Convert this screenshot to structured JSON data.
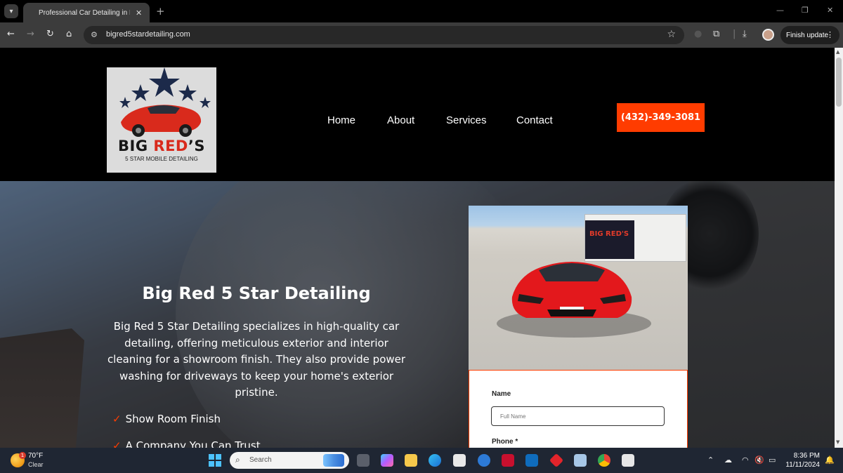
{
  "browser": {
    "tab_title": "Professional Car Detailing in Lu",
    "tab_close": "✕",
    "new_tab": "+",
    "url": "bigred5stardetailing.com",
    "finish_update": "Finish update",
    "window_controls": [
      "—",
      "❐",
      "✕"
    ]
  },
  "site": {
    "logo": {
      "line1_a": "BIG ",
      "line1_b": "RED",
      "line1_c": "’S",
      "line2": "5 STAR MOBILE DETAILING"
    },
    "nav": [
      "Home",
      "About",
      "Services",
      "Contact"
    ],
    "phone": "(432)-349-3081",
    "hero": {
      "title": "Big Red 5 Star Detailing",
      "description": "Big Red 5 Star Detailing specializes in high-quality car detailing, offering meticulous exterior and interior cleaning for a showroom finish. They also provide power washing for driveways to keep your home's exterior pristine.",
      "features": [
        "Show Room Finish",
        "A Company You Can Trust"
      ]
    },
    "photo": {
      "trailer_text": "BIG RED'S"
    },
    "form": {
      "name_label": "Name",
      "name_placeholder": "Full Name",
      "phone_label": "Phone *"
    }
  },
  "taskbar": {
    "weather_badge": "1",
    "temp": "70°F",
    "condition": "Clear",
    "search": "Search",
    "time": "8:36 PM",
    "date": "11/11/2024"
  },
  "colors": {
    "accent": "#ff3c00",
    "header_bg": "#000000",
    "taskbar_bg": "#1f2633"
  }
}
